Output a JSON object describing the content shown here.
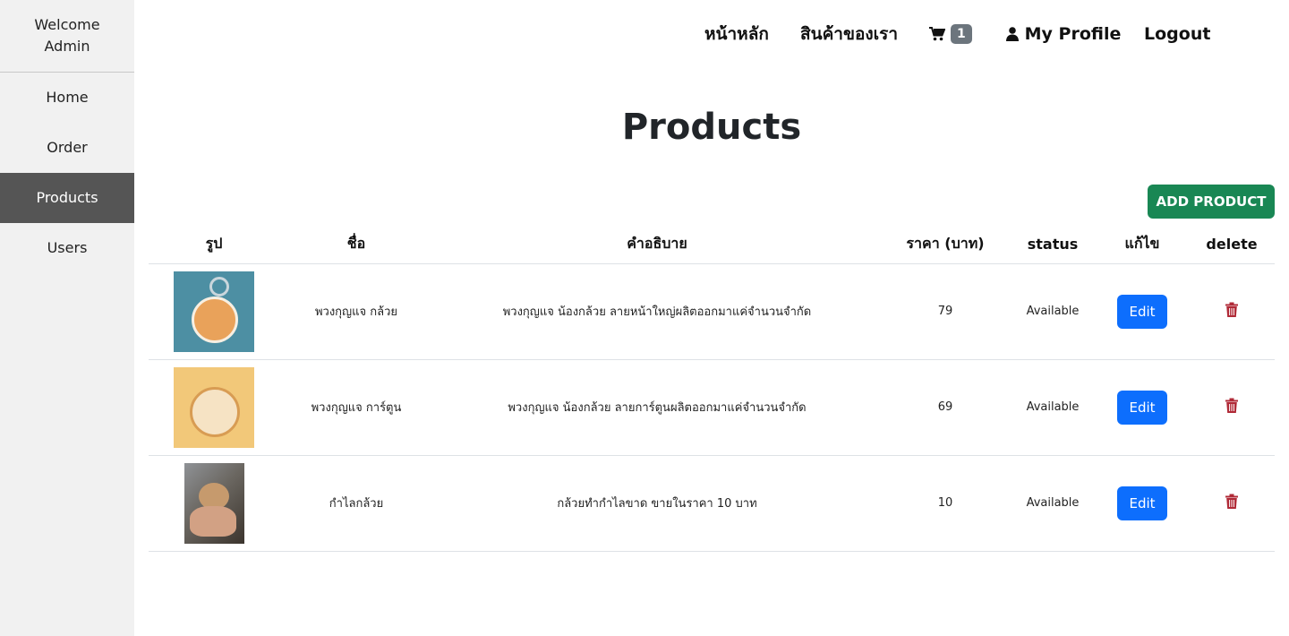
{
  "sidebar": {
    "welcome_line1": "Welcome",
    "welcome_line2": "Admin",
    "items": [
      {
        "label": "Home"
      },
      {
        "label": "Order"
      },
      {
        "label": "Products"
      },
      {
        "label": "Users"
      }
    ],
    "active": "Products"
  },
  "nav": {
    "home": "หน้าหลัก",
    "our_products": "สินค้าของเรา",
    "cart_icon": "shopping-cart-icon",
    "cart_count": "1",
    "profile_icon": "user-icon",
    "profile": "My Profile",
    "logout": "Logout"
  },
  "page": {
    "title": "Products",
    "add_button": "ADD PRODUCT"
  },
  "table": {
    "headers": [
      "รูป",
      "ชื่อ",
      "คำอธิบาย",
      "ราคา (บาท)",
      "status",
      "แก้ไข",
      "delete"
    ],
    "rows": [
      {
        "image": "keychain-banana-cat-image",
        "name": "พวงกุญแจ กล้วย",
        "description": "พวงกุญแจ น้องกล้วย ลายหน้าใหญ่ผลิตออกมาแค่จำนวนจำกัด",
        "price": "79",
        "status": "Available",
        "edit": "Edit"
      },
      {
        "image": "keychain-cartoon-cat-image",
        "name": "พวงกุญแจ การ์ตูน",
        "description": "พวงกุญแจ น้องกล้วย ลายการ์ตูนผลิตออกมาแค่จำนวนจำกัด",
        "price": "69",
        "status": "Available",
        "edit": "Edit"
      },
      {
        "image": "cat-with-bracelet-photo",
        "name": "กำไลกล้วย",
        "description": "กล้วยทำกำไลขาด ขายในราคา 10 บาท",
        "price": "10",
        "status": "Available",
        "edit": "Edit"
      }
    ]
  },
  "colors": {
    "sidebar_bg": "#f1f1f1",
    "sidebar_active": "#555555",
    "add_button": "#198754",
    "edit_button": "#0d6efd",
    "badge": "#6c757d",
    "delete_icon": "#b02a37"
  }
}
